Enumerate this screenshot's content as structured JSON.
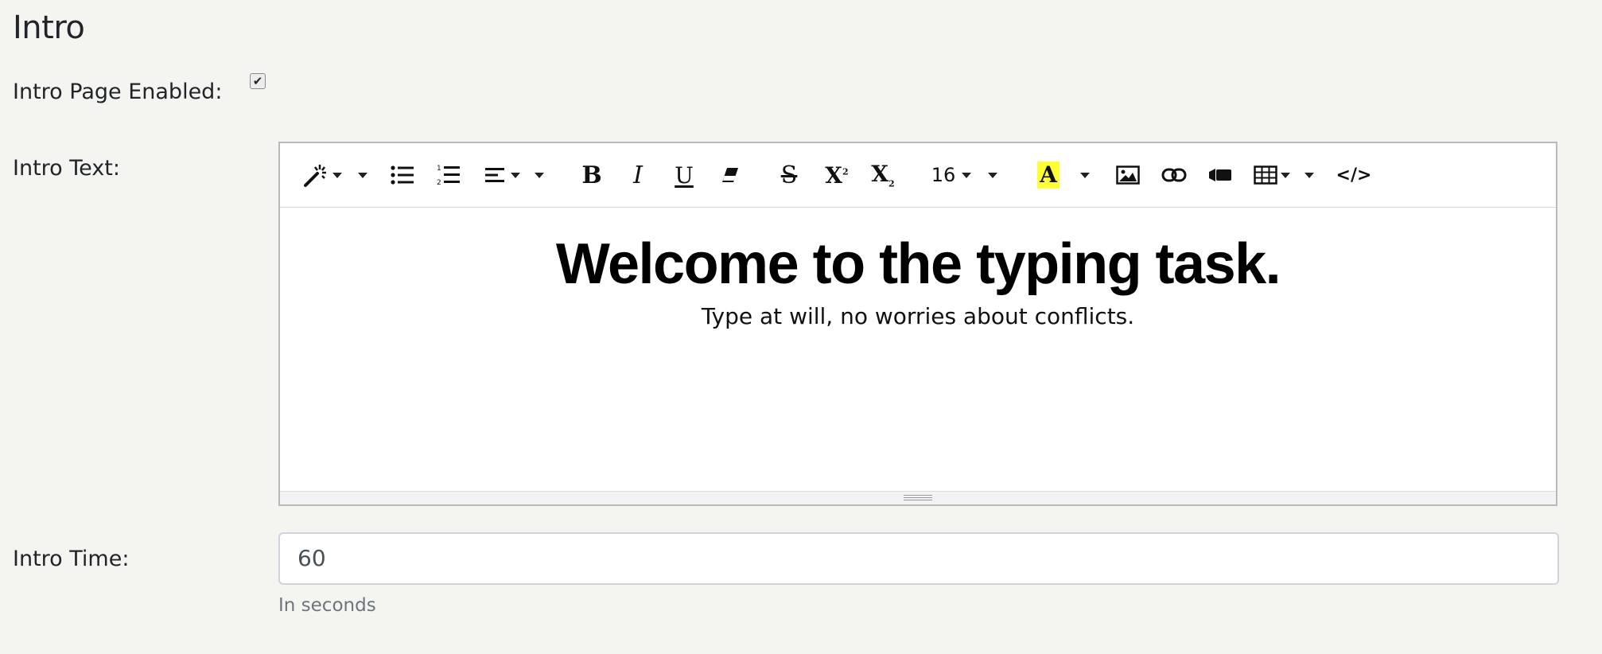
{
  "section": {
    "title": "Intro"
  },
  "fields": {
    "enabled_label": "Intro Page Enabled:",
    "enabled_checked": true,
    "text_label": "Intro Text:",
    "time_label": "Intro Time:",
    "time_value": "60",
    "time_help": "In seconds"
  },
  "editor": {
    "font_size": "16",
    "highlight_color": "#ffff33",
    "content": {
      "heading": "Welcome to the typing task.",
      "paragraph": "Type at will, no worries about conflicts."
    },
    "toolbar_icons": [
      "magic-icon",
      "bullet-list-icon",
      "numbered-list-icon",
      "align-icon",
      "bold-icon",
      "italic-icon",
      "underline-icon",
      "eraser-icon",
      "strikethrough-icon",
      "superscript-icon",
      "subscript-icon",
      "font-size-select",
      "highlight-color-icon",
      "image-icon",
      "link-icon",
      "video-icon",
      "table-icon",
      "code-view-icon"
    ],
    "code_view_label": "</>"
  }
}
